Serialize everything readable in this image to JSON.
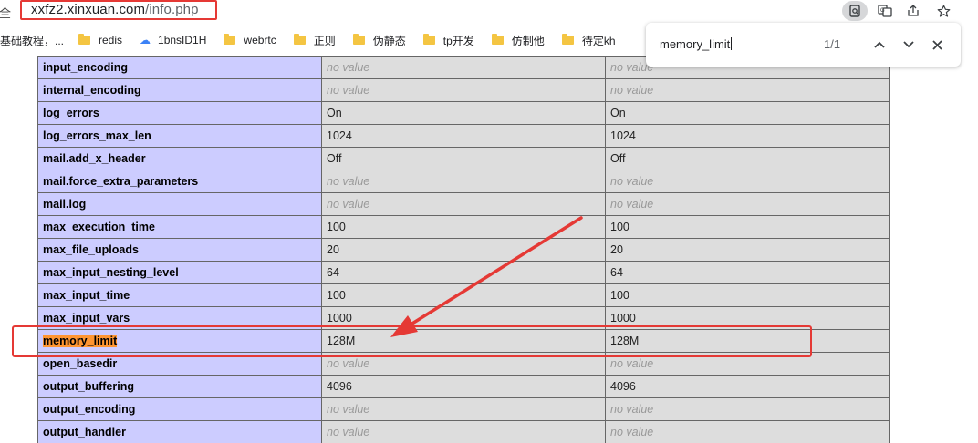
{
  "address_bar": {
    "insecure_label": "安全",
    "url_domain": "xxfz2.xinxuan.com",
    "url_path": "/info.php",
    "icons": [
      "search-page-icon",
      "translate-icon",
      "share-icon",
      "bookmark-star-icon"
    ]
  },
  "bookmarks": [
    {
      "label": "基础教程，...",
      "icon": "none"
    },
    {
      "label": "redis",
      "icon": "folder-icon"
    },
    {
      "label": "1bnsID1H",
      "icon": "cloud-icon"
    },
    {
      "label": "webrtc",
      "icon": "folder-icon"
    },
    {
      "label": "正则",
      "icon": "folder-icon"
    },
    {
      "label": "伪静态",
      "icon": "folder-icon"
    },
    {
      "label": "tp开发",
      "icon": "folder-icon"
    },
    {
      "label": "仿制他",
      "icon": "folder-icon"
    },
    {
      "label": "待定kh",
      "icon": "folder-icon"
    }
  ],
  "find_bar": {
    "query": "memory_limit",
    "count": "1/1"
  },
  "rows": [
    {
      "key": "input_encoding",
      "local": "no value",
      "master": "no value"
    },
    {
      "key": "internal_encoding",
      "local": "no value",
      "master": "no value"
    },
    {
      "key": "log_errors",
      "local": "On",
      "master": "On"
    },
    {
      "key": "log_errors_max_len",
      "local": "1024",
      "master": "1024"
    },
    {
      "key": "mail.add_x_header",
      "local": "Off",
      "master": "Off"
    },
    {
      "key": "mail.force_extra_parameters",
      "local": "no value",
      "master": "no value"
    },
    {
      "key": "mail.log",
      "local": "no value",
      "master": "no value"
    },
    {
      "key": "max_execution_time",
      "local": "100",
      "master": "100"
    },
    {
      "key": "max_file_uploads",
      "local": "20",
      "master": "20"
    },
    {
      "key": "max_input_nesting_level",
      "local": "64",
      "master": "64"
    },
    {
      "key": "max_input_time",
      "local": "100",
      "master": "100"
    },
    {
      "key": "max_input_vars",
      "local": "1000",
      "master": "1000"
    },
    {
      "key": "memory_limit",
      "local": "128M",
      "master": "128M",
      "highlighted": true
    },
    {
      "key": "open_basedir",
      "local": "no value",
      "master": "no value"
    },
    {
      "key": "output_buffering",
      "local": "4096",
      "master": "4096"
    },
    {
      "key": "output_encoding",
      "local": "no value",
      "master": "no value"
    },
    {
      "key": "output_handler",
      "local": "no value",
      "master": "no value"
    }
  ],
  "colors": {
    "annotation": "#e53935",
    "key_cell": "#ccccff",
    "value_cell": "#dddddd",
    "find_match": "#ff9632"
  }
}
